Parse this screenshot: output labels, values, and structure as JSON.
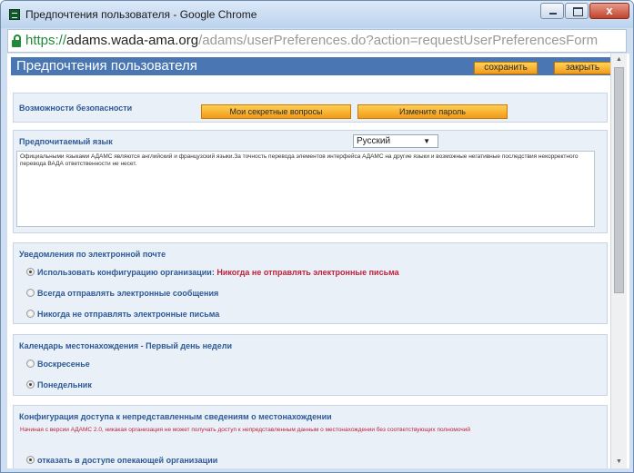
{
  "window": {
    "title": "Предпочтения пользователя - Google Chrome",
    "controls": {
      "minimize": "minimize",
      "maximize": "maximize",
      "close": "close"
    }
  },
  "address_bar": {
    "scheme": "https://",
    "host": "adams.wada-ama.org",
    "path": "/adams/userPreferences.do?action=requestUserPreferencesForm"
  },
  "header": {
    "title": "Предпочтения пользователя",
    "save_label": "сохранить",
    "close_label": "закрыть"
  },
  "security": {
    "title": "Возможности безопасности",
    "questions_button": "Мои секретные вопросы",
    "password_button": "Измените пароль"
  },
  "language": {
    "title": "Предпочитаемый язык",
    "selected": "Русский",
    "notice": "Официальными языками АДАМС являются английский и французский языки.За точность перевода элементов интерфейса АДАМС на другие языки и возможные негативные последствия некорректного перевода ВАДА ответственности не несет."
  },
  "email": {
    "title": "Уведомления по электронной почте",
    "options": [
      {
        "label": "Использовать конфигурацию организации:",
        "suffix": "Никогда не отправлять электронные письма",
        "selected": true
      },
      {
        "label": "Всегда отправлять электронные сообщения",
        "selected": false
      },
      {
        "label": "Никогда не отправлять электронные письма",
        "selected": false
      }
    ]
  },
  "calendar": {
    "title": "Календарь местонахождения - Первый день недели",
    "options": [
      {
        "label": "Воскресенье",
        "selected": false
      },
      {
        "label": "Понедельник",
        "selected": true
      }
    ]
  },
  "access": {
    "title": "Конфигурация доступа к непредставленным сведениям о местонахождении",
    "note": "Начиная с версии АДАМС 2.0, никакая организация не может получать доступ к непредставленным данным о местонахождении без соответствующих полномочий",
    "options": [
      {
        "label": "отказать в доступе опекающей организации",
        "selected": true
      }
    ]
  },
  "colors": {
    "header_bg": "#4a77b4",
    "panel_bg": "#eaf0f7",
    "label_blue": "#2d5a96",
    "alert_red": "#c0203a",
    "button_orange": "#f7b433"
  }
}
